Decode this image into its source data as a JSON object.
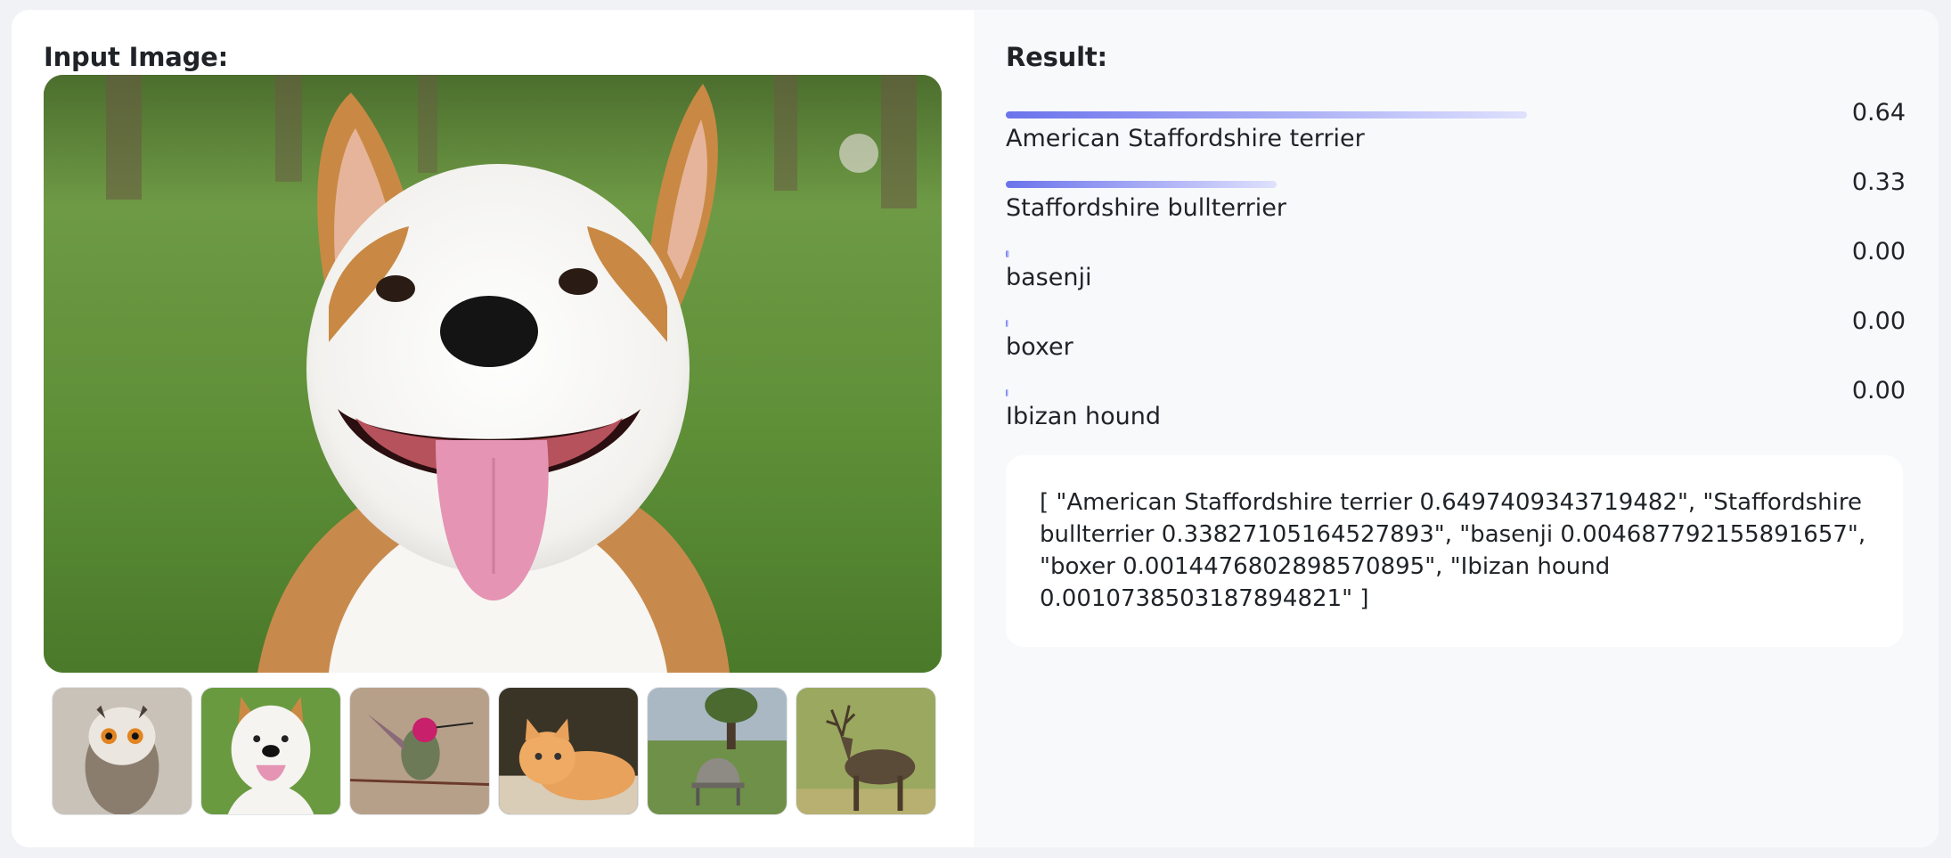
{
  "input_panel": {
    "title": "Input Image:",
    "main_image": "smiling white and tan dog in grassy park",
    "examples": [
      {
        "name": "owl"
      },
      {
        "name": "dog"
      },
      {
        "name": "hummingbird"
      },
      {
        "name": "kitten"
      },
      {
        "name": "park bench"
      },
      {
        "name": "deer"
      }
    ]
  },
  "result_panel": {
    "title": "Result:",
    "predictions": [
      {
        "label": "American Staffordshire terrier",
        "value": "0.64",
        "score": 0.6497
      },
      {
        "label": "Staffordshire bullterrier",
        "value": "0.33",
        "score": 0.3383
      },
      {
        "label": "basenji",
        "value": "0.00",
        "score": 0.0047
      },
      {
        "label": "boxer",
        "value": "0.00",
        "score": 0.0014
      },
      {
        "label": "Ibizan hound",
        "value": "0.00",
        "score": 0.0011
      }
    ],
    "raw_output": "[ \"American Staffordshire terrier 0.6497409343719482\", \"Staffordshire bullterrier 0.33827105164527893\", \"basenji 0.004687792155891657\", \"boxer 0.0014476802898570895\", \"Ibizan hound 0.0010738503187894821\" ]"
  },
  "colors": {
    "bar_start": "#6b73ec",
    "bar_end": "#dfe1fd",
    "panel_right": "#f8f9fb"
  }
}
